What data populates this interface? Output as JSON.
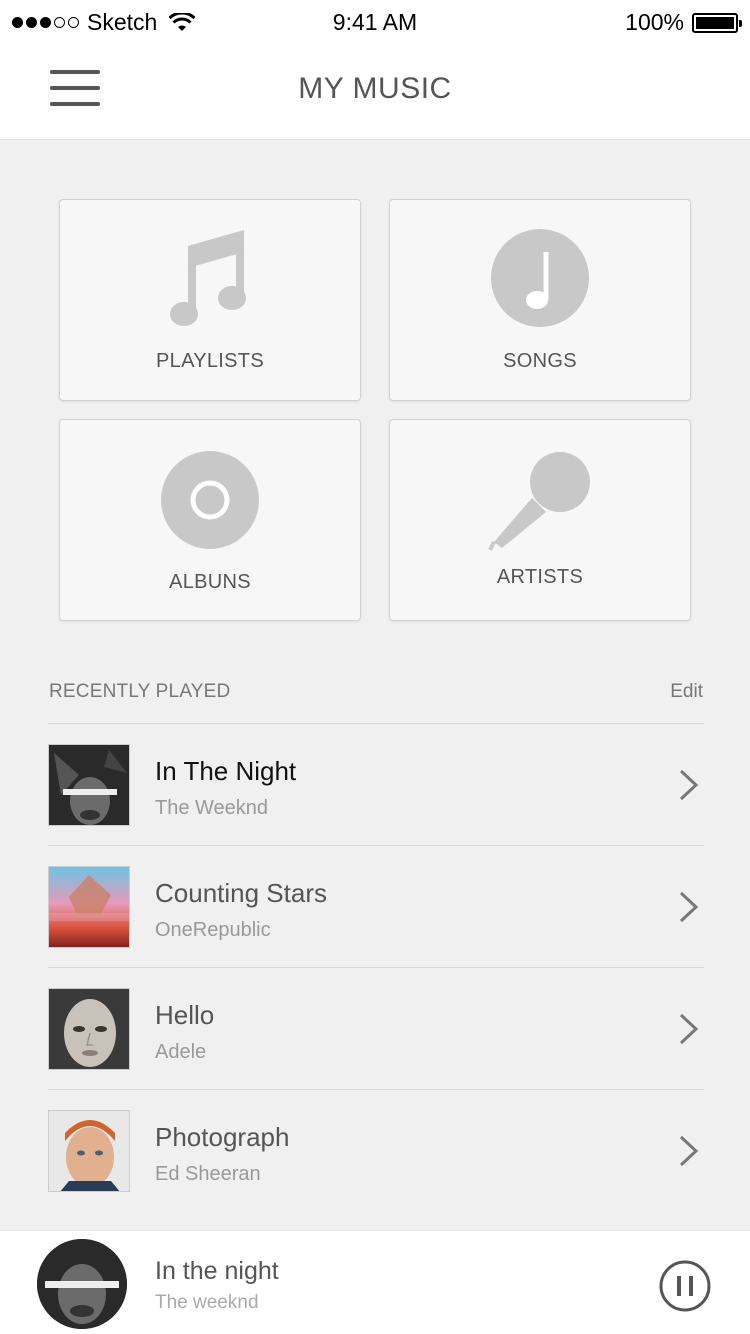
{
  "status_bar": {
    "carrier": "Sketch",
    "time": "9:41 AM",
    "battery": "100%"
  },
  "nav": {
    "title": "MY MUSIC",
    "menu_icon": "hamburger-menu-icon"
  },
  "tiles": [
    {
      "label": "PLAYLISTS",
      "icon": "music-notes-icon"
    },
    {
      "label": "SONGS",
      "icon": "music-note-circle-icon"
    },
    {
      "label": "ALBUNS",
      "icon": "disc-icon"
    },
    {
      "label": "ARTISTS",
      "icon": "microphone-icon"
    }
  ],
  "recently_played": {
    "title": "RECENTLY PLAYED",
    "edit_label": "Edit",
    "items": [
      {
        "title": "In The Night",
        "artist": "The Weeknd",
        "active": true
      },
      {
        "title": "Counting Stars",
        "artist": "OneRepublic",
        "active": false
      },
      {
        "title": "Hello",
        "artist": "Adele",
        "active": false
      },
      {
        "title": "Photograph",
        "artist": "Ed Sheeran",
        "active": false
      }
    ]
  },
  "now_playing": {
    "title": "In the night",
    "artist": "The weeknd",
    "control_icon": "pause-icon"
  },
  "colors": {
    "background": "#f0f0f0",
    "icon_gray": "#c8c8c8",
    "text_gray": "#555555",
    "subtext_gray": "#999999"
  }
}
